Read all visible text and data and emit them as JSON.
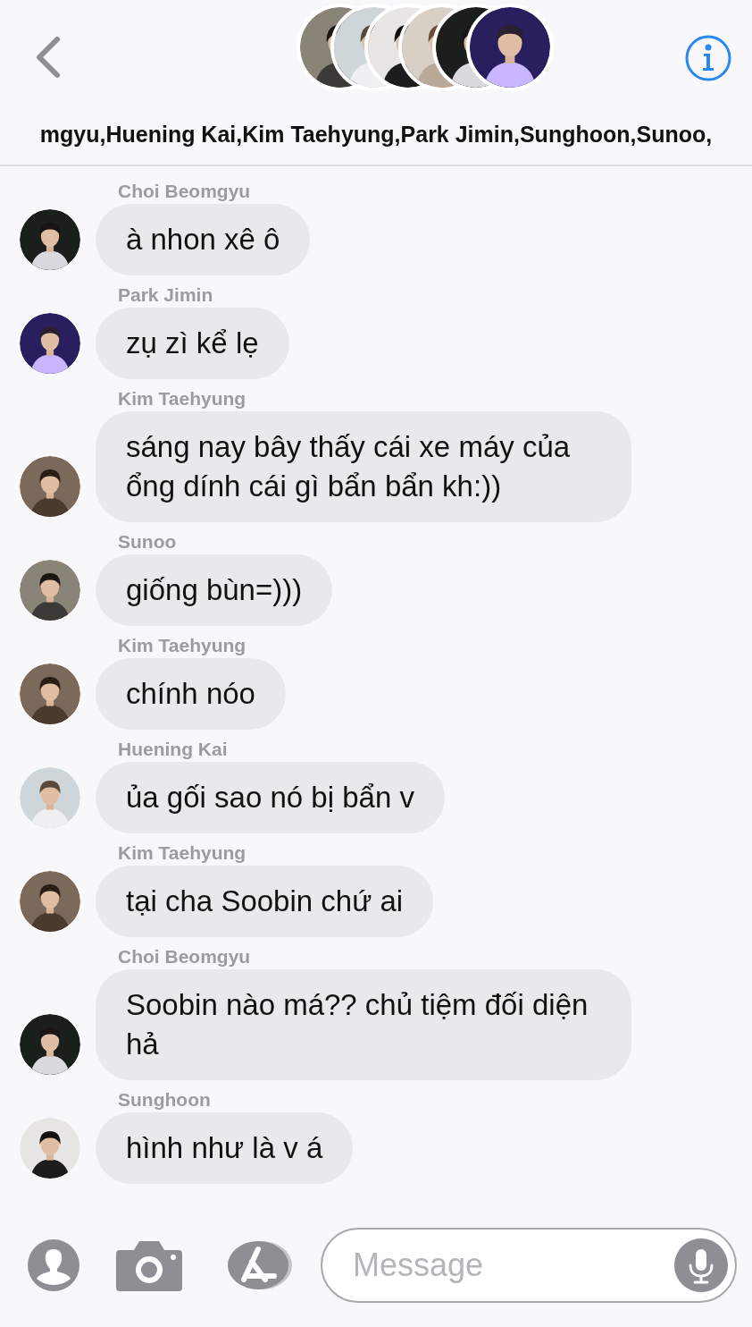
{
  "header": {
    "members": "mgyu,Huening Kai,Kim Taehyung,Park Jimin,Sunghoon,Sunoo,"
  },
  "messages": [
    {
      "sender": "Choi Beomgyu",
      "text": "à nhon xê ô"
    },
    {
      "sender": "Park Jimin",
      "text": "zụ zì kể lẹ"
    },
    {
      "sender": "Kim Taehyung",
      "text": "sáng nay bây thấy cái xe máy của ổng dính cái gì bẩn bẩn kh:))"
    },
    {
      "sender": "Sunoo",
      "text": "giống bùn=)))"
    },
    {
      "sender": "Kim Taehyung",
      "text": "chính nóo"
    },
    {
      "sender": "Huening Kai",
      "text": "ủa gối sao nó bị bẩn v"
    },
    {
      "sender": "Kim Taehyung",
      "text": "tại cha Soobin chứ ai"
    },
    {
      "sender": "Choi Beomgyu",
      "text": "Soobin nào má?? chủ tiệm đối diện hả"
    },
    {
      "sender": "Sunghoon",
      "text": "hình như là v á"
    }
  ],
  "composer": {
    "placeholder": "Message"
  }
}
